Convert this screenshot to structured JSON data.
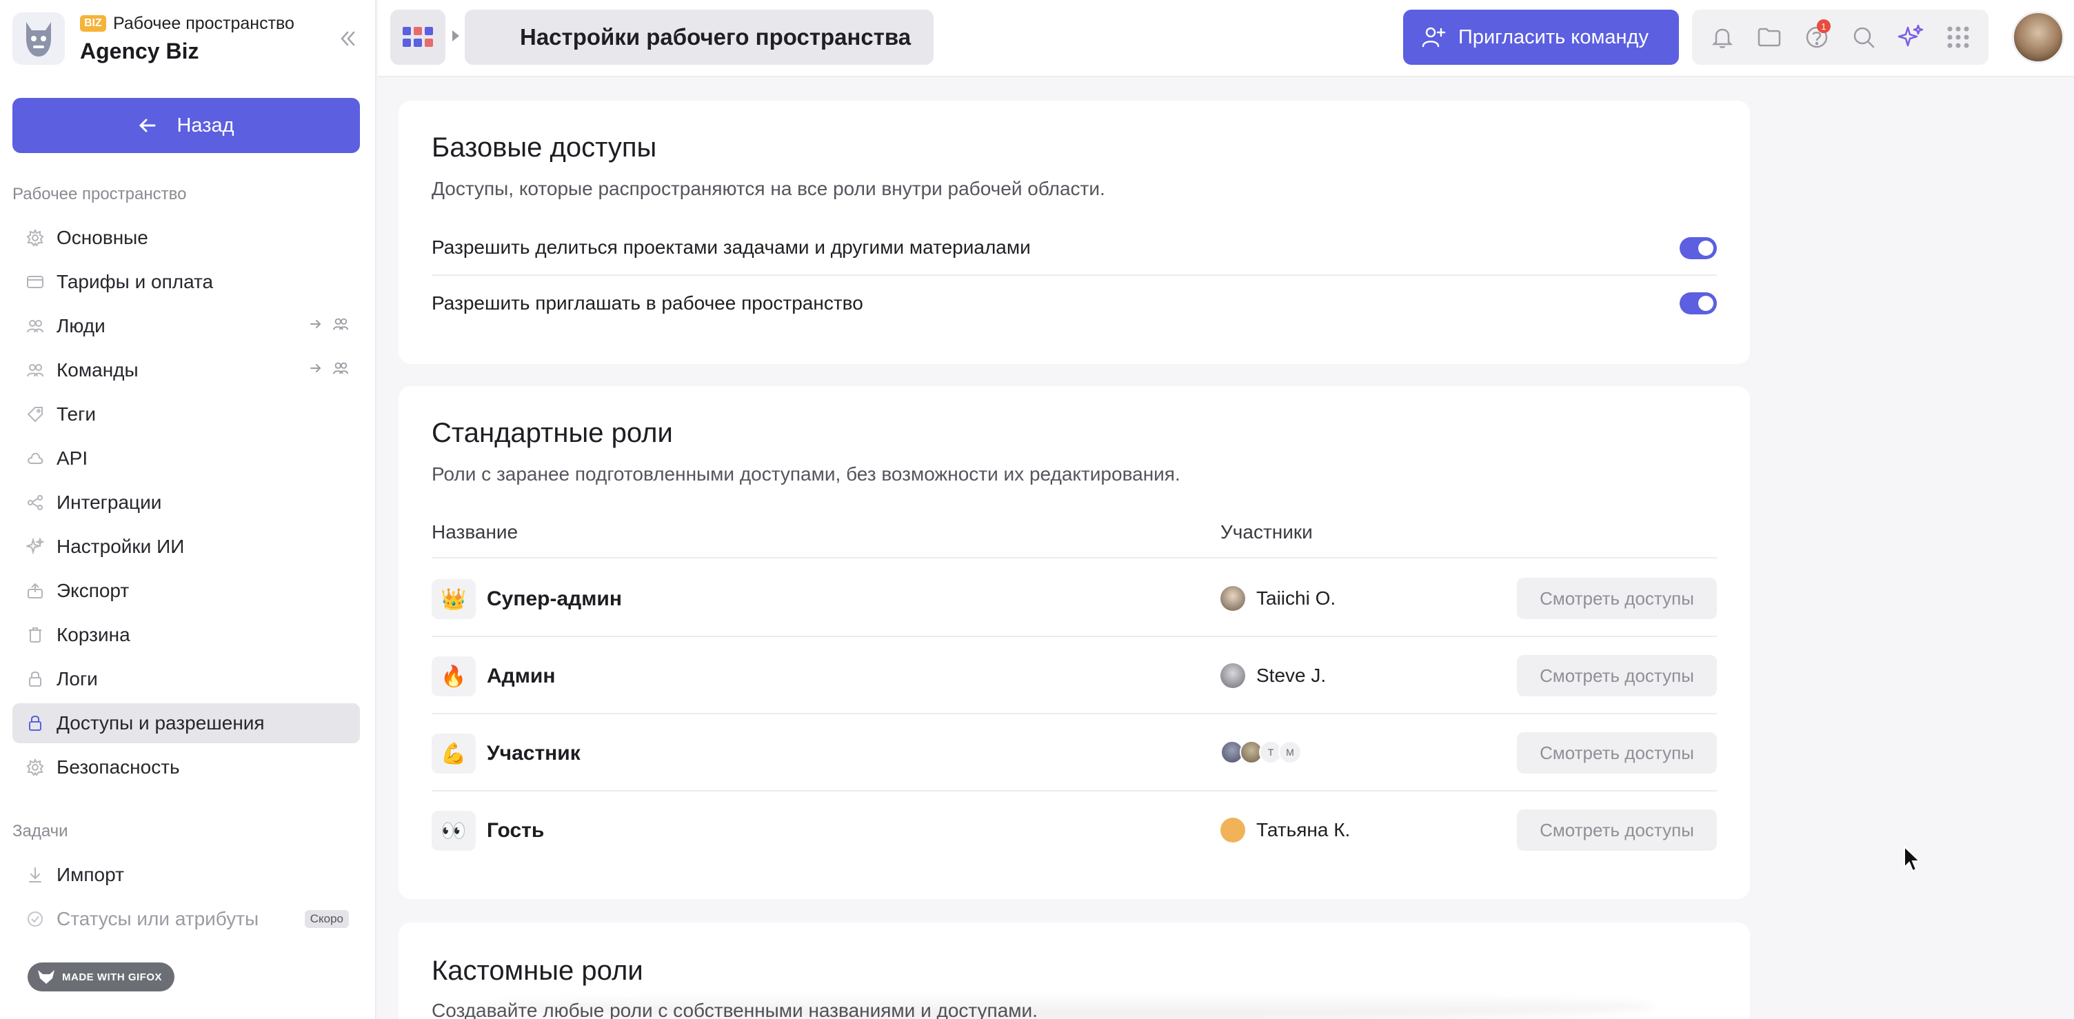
{
  "workspace": {
    "badge": "BIZ",
    "label": "Рабочее пространство",
    "name": "Agency Biz"
  },
  "sidebar": {
    "back_label": "Назад",
    "section_workspace": "Рабочее пространство",
    "items": [
      {
        "label": "Основные",
        "icon": "gear-icon"
      },
      {
        "label": "Тарифы и оплата",
        "icon": "card-icon"
      },
      {
        "label": "Люди",
        "icon": "people-icon"
      },
      {
        "label": "Команды",
        "icon": "team-icon"
      },
      {
        "label": "Теги",
        "icon": "tag-icon"
      },
      {
        "label": "API",
        "icon": "cloud-icon"
      },
      {
        "label": "Интеграции",
        "icon": "integrations-icon"
      },
      {
        "label": "Настройки ИИ",
        "icon": "sparkle-icon"
      },
      {
        "label": "Экспорт",
        "icon": "export-icon"
      },
      {
        "label": "Корзина",
        "icon": "trash-icon"
      },
      {
        "label": "Логи",
        "icon": "lock-icon"
      },
      {
        "label": "Доступы и разрешения",
        "icon": "lock-icon",
        "active": true
      },
      {
        "label": "Безопасность",
        "icon": "shield-icon"
      }
    ],
    "section_tasks": "Задачи",
    "task_items": [
      {
        "label": "Импорт",
        "icon": "import-icon"
      },
      {
        "label": "Статусы или атрибуты",
        "icon": "status-icon",
        "badge": "Скоро"
      }
    ],
    "gifox_label": "MADE WITH GIFOX"
  },
  "topbar": {
    "breadcrumb": "Настройки рабочего пространства",
    "invite_label": "Пригласить команду",
    "notification_count": "1"
  },
  "basic_access": {
    "title": "Базовые доступы",
    "description": "Доступы, которые распространяются на все роли внутри рабочей области.",
    "permissions": [
      {
        "label": "Разрешить делиться проектами задачами и другими материалами",
        "enabled": true
      },
      {
        "label": "Разрешить приглашать в рабочее пространство",
        "enabled": true
      }
    ]
  },
  "standard_roles": {
    "title": "Стандартные роли",
    "description": "Роли с заранее подготовленными доступами, без возможности их редактирования.",
    "col_name": "Название",
    "col_members": "Участники",
    "view_label": "Смотреть доступы",
    "roles": [
      {
        "emoji": "👑",
        "name": "Супер-админ",
        "member": "Taiichi O."
      },
      {
        "emoji": "🔥",
        "name": "Админ",
        "member": "Steve J."
      },
      {
        "emoji": "💪",
        "name": "Участник",
        "member": "",
        "initials": [
          "T",
          "M"
        ]
      },
      {
        "emoji": "👀",
        "name": "Гость",
        "member": "Татьяна К."
      }
    ]
  },
  "custom_roles": {
    "title": "Кастомные роли",
    "description": "Создавайте любые роли с собственными названиями и доступами."
  },
  "colors": {
    "accent": "#5b5fe0",
    "notification": "#e84c3d"
  }
}
